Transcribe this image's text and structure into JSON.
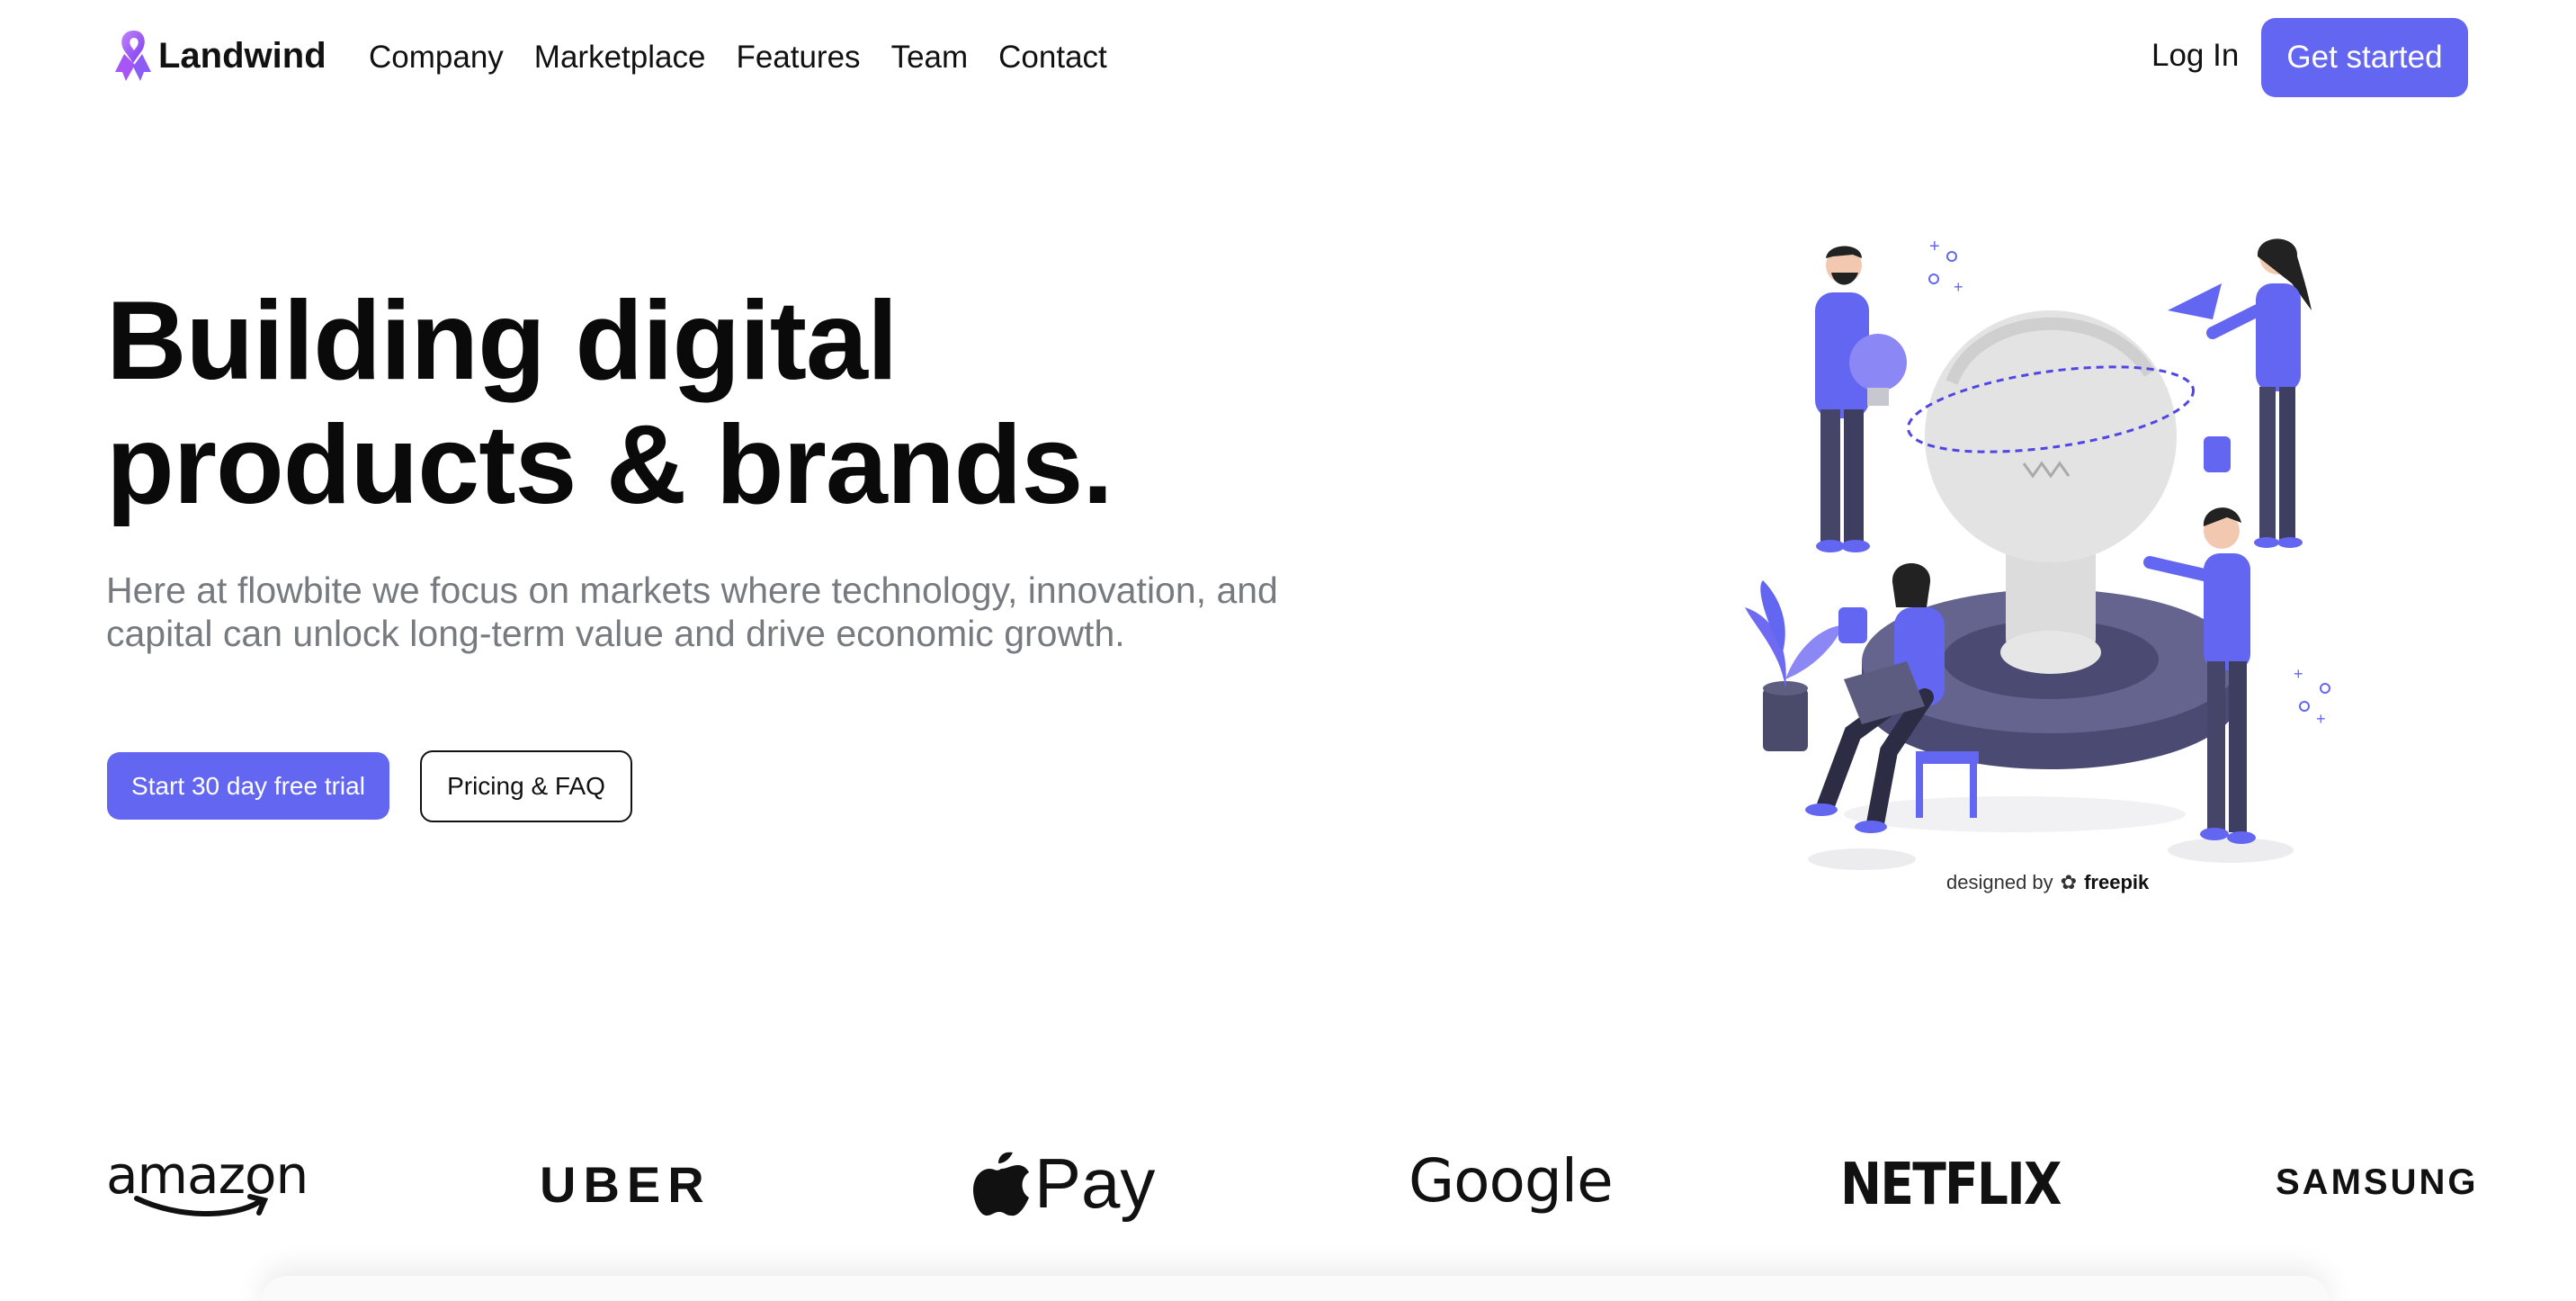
{
  "brand": {
    "name": "Landwind",
    "accent": "#6366f1"
  },
  "nav": {
    "links": [
      "Company",
      "Marketplace",
      "Features",
      "Team",
      "Contact"
    ],
    "login": "Log In",
    "cta": "Get started"
  },
  "hero": {
    "headline_line1": "Building digital",
    "headline_line2": "products & brands.",
    "subtext": "Here at flowbite we focus on markets where technology, innovation, and capital can unlock long-term value and drive economic growth.",
    "primary_button": "Start 30 day free trial",
    "secondary_button": "Pricing & FAQ"
  },
  "illustration": {
    "credit_prefix": "designed by",
    "credit_brand": "freepik"
  },
  "logos": {
    "amazon": "amazon",
    "uber": "UBER",
    "applepay": "Pay",
    "google": "Google",
    "netflix": "NETFLIX",
    "samsung": "SAMSUNG"
  }
}
